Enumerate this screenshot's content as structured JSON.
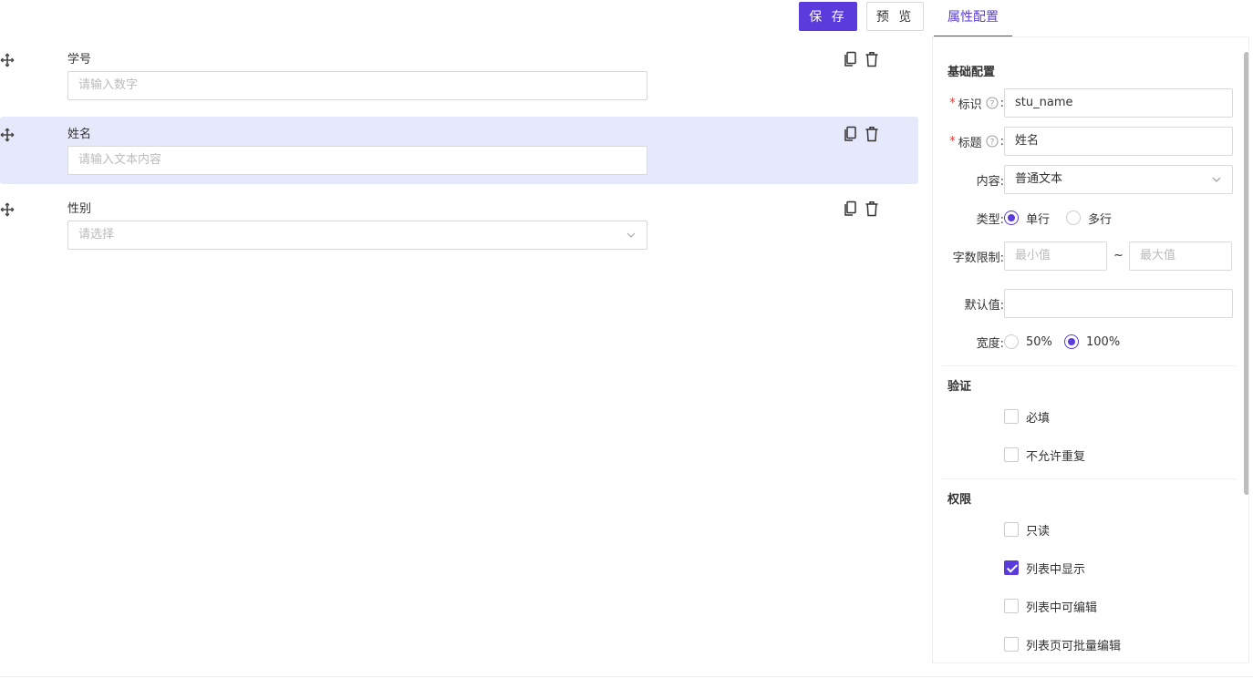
{
  "toolbar": {
    "save_label": "保 存",
    "preview_label": "预 览"
  },
  "fields": [
    {
      "label": "学号",
      "placeholder": "请输入数字",
      "kind": "input"
    },
    {
      "label": "姓名",
      "placeholder": "请输入文本内容",
      "kind": "input",
      "active": true
    },
    {
      "label": "性别",
      "placeholder": "请选择",
      "kind": "select"
    }
  ],
  "panel": {
    "tab": "属性配置",
    "basic_title": "基础配置",
    "id_label": "标识",
    "id_value": "stu_name",
    "title_label": "标题",
    "title_value": "姓名",
    "content_label": "内容:",
    "content_value": "普通文本",
    "type_label": "类型:",
    "type_options": [
      "单行",
      "多行"
    ],
    "type_selected": "单行",
    "length_label": "字数限制:",
    "min_placeholder": "最小值",
    "max_placeholder": "最大值",
    "range_sep": "~",
    "default_label": "默认值:",
    "default_value": "",
    "width_label": "宽度:",
    "width_options": [
      "50%",
      "100%"
    ],
    "width_selected": "100%",
    "validation_title": "验证",
    "validation_options": [
      {
        "label": "必填",
        "checked": false
      },
      {
        "label": "不允许重复",
        "checked": false
      }
    ],
    "permission_title": "权限",
    "permission_options": [
      {
        "label": "只读",
        "checked": false
      },
      {
        "label": "列表中显示",
        "checked": true
      },
      {
        "label": "列表中可编辑",
        "checked": false
      },
      {
        "label": "列表页可批量编辑",
        "checked": false
      }
    ]
  },
  "colors": {
    "accent": "#5b3bdc",
    "active_row": "#e6e9fb",
    "required": "#e53935"
  }
}
